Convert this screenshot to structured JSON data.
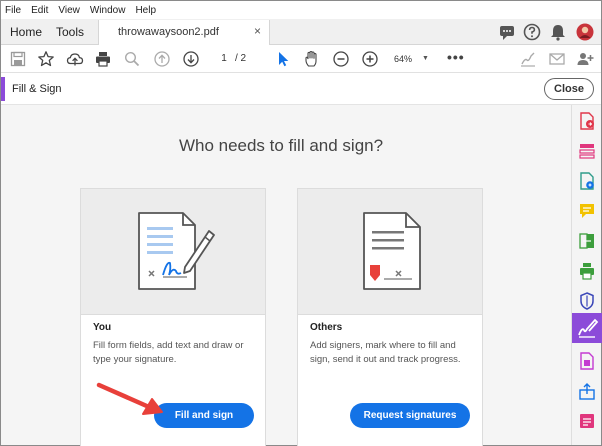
{
  "menu": [
    "File",
    "Edit",
    "View",
    "Window",
    "Help"
  ],
  "tabs": {
    "home": "Home",
    "tools": "Tools",
    "document": "throwawaysoon2.pdf",
    "close_glyph": "×"
  },
  "toolbar": {
    "page_current": "1",
    "page_total": "/ 2",
    "zoom": "64%",
    "zoom_caret": "▼",
    "more": "•••"
  },
  "panel": {
    "title": "Fill & Sign",
    "close_label": "Close"
  },
  "main": {
    "headline": "Who needs to fill and sign?",
    "cards": [
      {
        "title": "You",
        "description": "Fill form fields, add text and draw or type your signature.",
        "button": "Fill and sign"
      },
      {
        "title": "Others",
        "description": "Add signers, mark where to fill and sign, send it out and track progress.",
        "button": "Request signatures"
      }
    ]
  },
  "colors": {
    "accent_purple": "#8c4bd9",
    "primary_blue": "#1473e6",
    "annotation_red": "#e8403a"
  },
  "icons": {
    "toolbar": [
      "save-icon",
      "bookmark-star-icon",
      "upload-cloud-icon",
      "print-icon",
      "zoom-search-icon",
      "page-up-icon",
      "page-down-icon",
      "select-cursor-icon",
      "hand-icon",
      "zoom-out-icon",
      "zoom-in-icon",
      "sign-icon",
      "mail-icon",
      "add-user-icon"
    ],
    "rail": [
      "export-pdf-icon",
      "organize-pages-icon",
      "edit-pdf-icon",
      "comment-icon",
      "combine-files-icon",
      "print-production-icon",
      "protect-icon",
      "fill-sign-icon",
      "create-pdf-icon",
      "send-file-icon",
      "more-tools-icon"
    ]
  }
}
